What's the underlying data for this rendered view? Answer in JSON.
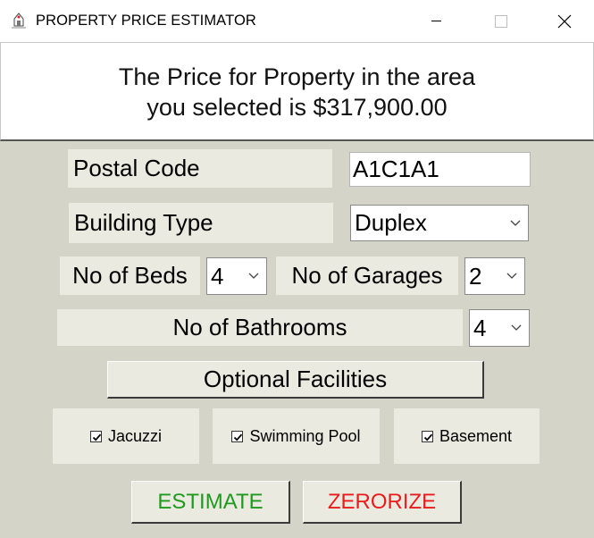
{
  "window": {
    "title": "PROPERTY PRICE ESTIMATOR",
    "icon": "house-drawing-icon"
  },
  "result": {
    "line1": "The Price for Property in the area",
    "line2": "you selected is $317,900.00"
  },
  "form": {
    "postal_code": {
      "label": "Postal Code",
      "value": "A1C1A1"
    },
    "building_type": {
      "label": "Building Type",
      "value": "Duplex"
    },
    "beds": {
      "label": "No of Beds",
      "value": "4"
    },
    "garages": {
      "label": "No of Garages",
      "value": "2"
    },
    "bathrooms": {
      "label": "No of Bathrooms",
      "value": "4"
    }
  },
  "optional": {
    "button_label": "Optional Facilities",
    "jacuzzi": {
      "label": "Jacuzzi",
      "checked": true
    },
    "pool": {
      "label": "Swimming Pool",
      "checked": true
    },
    "basement": {
      "label": "Basement",
      "checked": true
    }
  },
  "actions": {
    "estimate_label": "ESTIMATE",
    "zerorize_label": "ZERORIZE"
  },
  "colors": {
    "estimate": "#1f9a1f",
    "zerorize": "#e81c1c",
    "window_bg": "#d4d4c9",
    "label_bg": "#ebeae0"
  }
}
